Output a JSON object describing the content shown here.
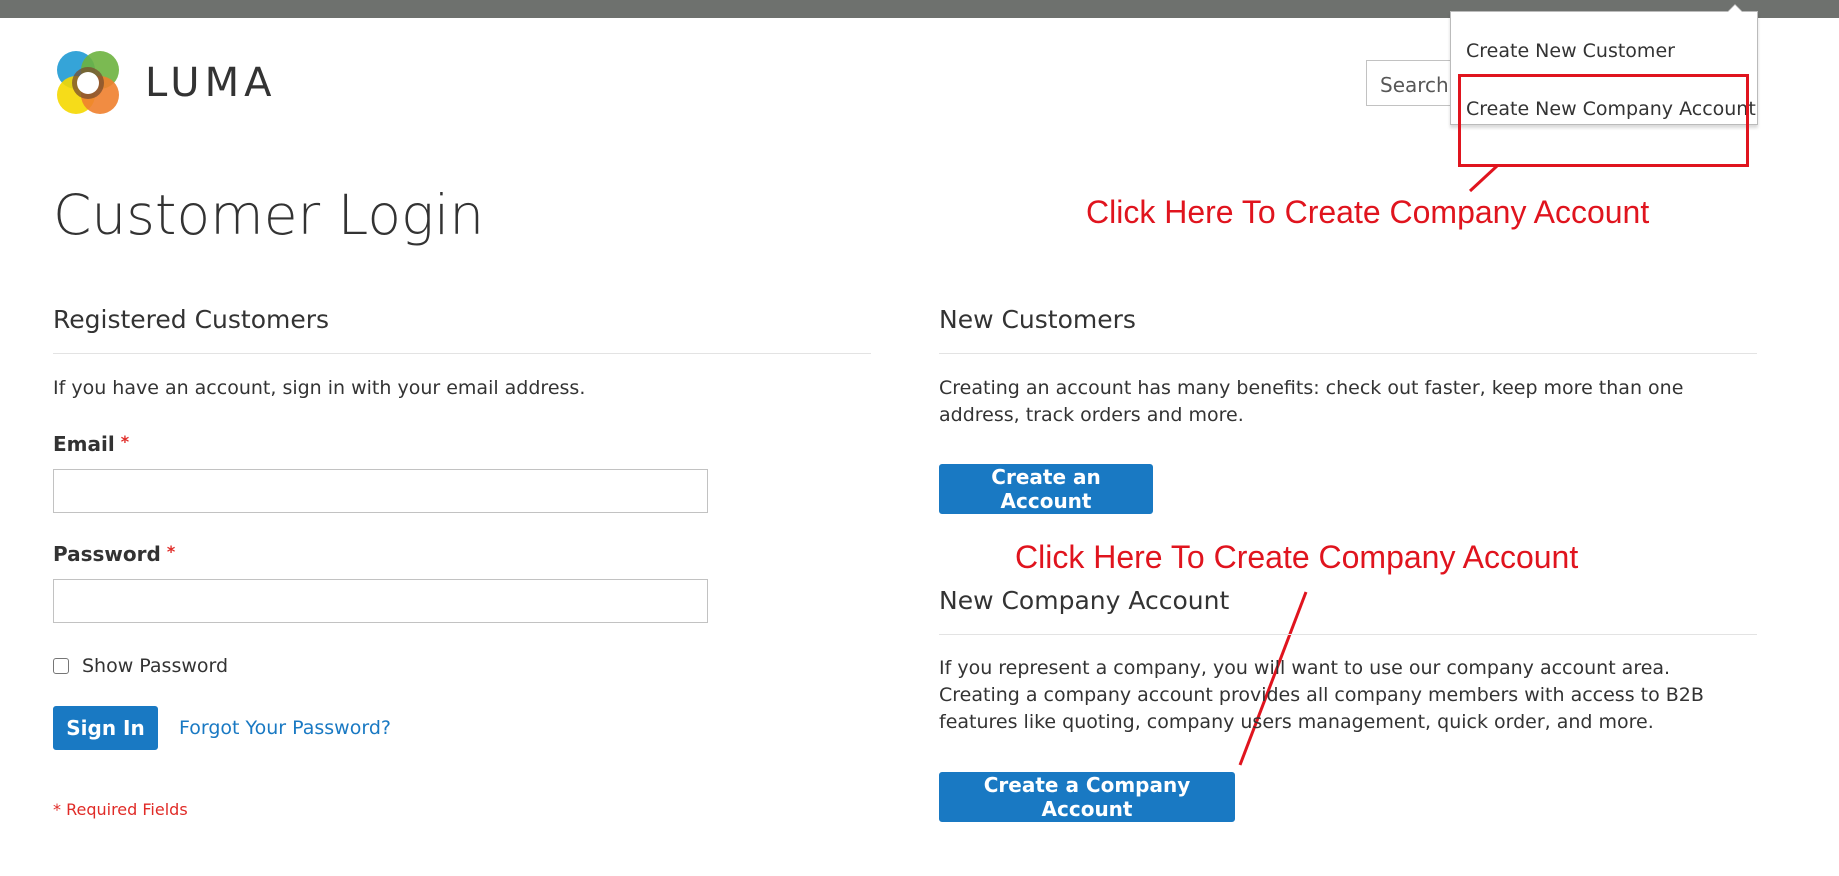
{
  "header": {
    "logo_text": "LUMA",
    "search_placeholder": "Search"
  },
  "dropdown": {
    "items": [
      {
        "label": "Create New Customer"
      },
      {
        "label": "Create New Company Account"
      }
    ]
  },
  "annotations": {
    "top_callout": "Click Here To Create Company Account",
    "bottom_callout": "Click Here To Create Company Account",
    "color": "#e0141e"
  },
  "page": {
    "title": "Customer Login"
  },
  "registered": {
    "title": "Registered Customers",
    "intro": "If you have an account, sign in with your email address.",
    "email_label": "Email",
    "email_value": "",
    "password_label": "Password",
    "password_value": "",
    "required_mark": "*",
    "show_password_label": "Show Password",
    "sign_in_label": "Sign In",
    "forgot_password_label": "Forgot Your Password?",
    "required_fields_note": "* Required Fields"
  },
  "new_customers": {
    "title": "New Customers",
    "intro": "Creating an account has many benefits: check out faster, keep more than one address, track orders and more.",
    "create_account_label": "Create an Account"
  },
  "new_company": {
    "title": "New Company Account",
    "intro": "If you represent a company, you will want to use our company account area. Creating a company account provides all company members with access to B2B features like quoting, company users management, quick order, and more.",
    "create_company_label": "Create a Company Account"
  },
  "colors": {
    "primary_button": "#1979c3",
    "link": "#1979c3",
    "required": "#e02b27",
    "topbar": "#6e716e"
  }
}
